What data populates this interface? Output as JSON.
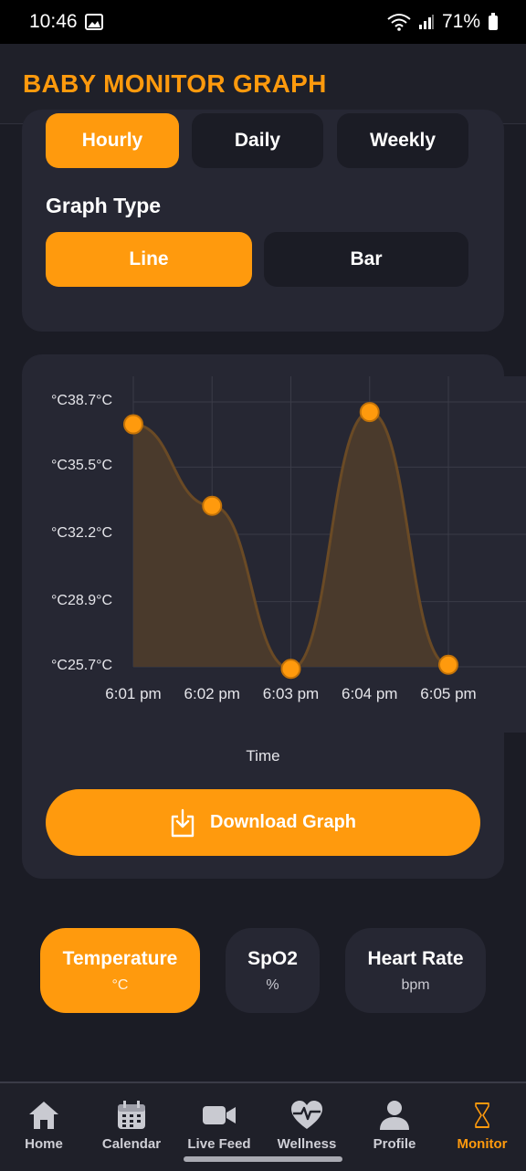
{
  "status_bar": {
    "time": "10:46",
    "battery": "71%"
  },
  "app_bar": {
    "title": "BABY MONITOR GRAPH"
  },
  "range_tabs": [
    {
      "label": "Hourly",
      "active": true
    },
    {
      "label": "Daily",
      "active": false
    },
    {
      "label": "Weekly",
      "active": false
    }
  ],
  "graph_type": {
    "label": "Graph Type",
    "options": [
      {
        "label": "Line",
        "active": true
      },
      {
        "label": "Bar",
        "active": false
      }
    ]
  },
  "chart_data": {
    "type": "line",
    "x": [
      "6:01 pm",
      "6:02 pm",
      "6:03 pm",
      "6:04 pm",
      "6:05 pm"
    ],
    "series": [
      {
        "values": [
          37.6,
          33.6,
          25.6,
          38.2,
          25.8
        ]
      }
    ],
    "ytick_labels": [
      "°C38.7°C",
      "°C35.5°C",
      "°C32.2°C",
      "°C28.9°C",
      "°C25.7°C"
    ],
    "yticks": [
      38.7,
      35.5,
      32.2,
      28.9,
      25.7
    ],
    "ylim": [
      25.7,
      38.7
    ],
    "xlabel": "Time",
    "ylabel": "",
    "grid": true,
    "colors": {
      "line": "#ff9a0d",
      "fill": "#4a3a2c",
      "grid": "#3a3b47"
    }
  },
  "download_button": {
    "label": "Download Graph"
  },
  "metrics": [
    {
      "name": "Temperature",
      "unit": "°C",
      "active": true
    },
    {
      "name": "SpO2",
      "unit": "%",
      "active": false
    },
    {
      "name": "Heart Rate",
      "unit": "bpm",
      "active": false
    }
  ],
  "bottom_nav": [
    {
      "label": "Home",
      "icon": "home-icon"
    },
    {
      "label": "Calendar",
      "icon": "calendar-icon"
    },
    {
      "label": "Live Feed",
      "icon": "video-icon"
    },
    {
      "label": "Wellness",
      "icon": "heart-pulse-icon"
    },
    {
      "label": "Profile",
      "icon": "person-icon"
    },
    {
      "label": "Monitor",
      "icon": "hourglass-icon",
      "active": true
    }
  ],
  "colors": {
    "accent": "#ff9a0d",
    "background": "#1b1c25",
    "card": "#262733"
  }
}
